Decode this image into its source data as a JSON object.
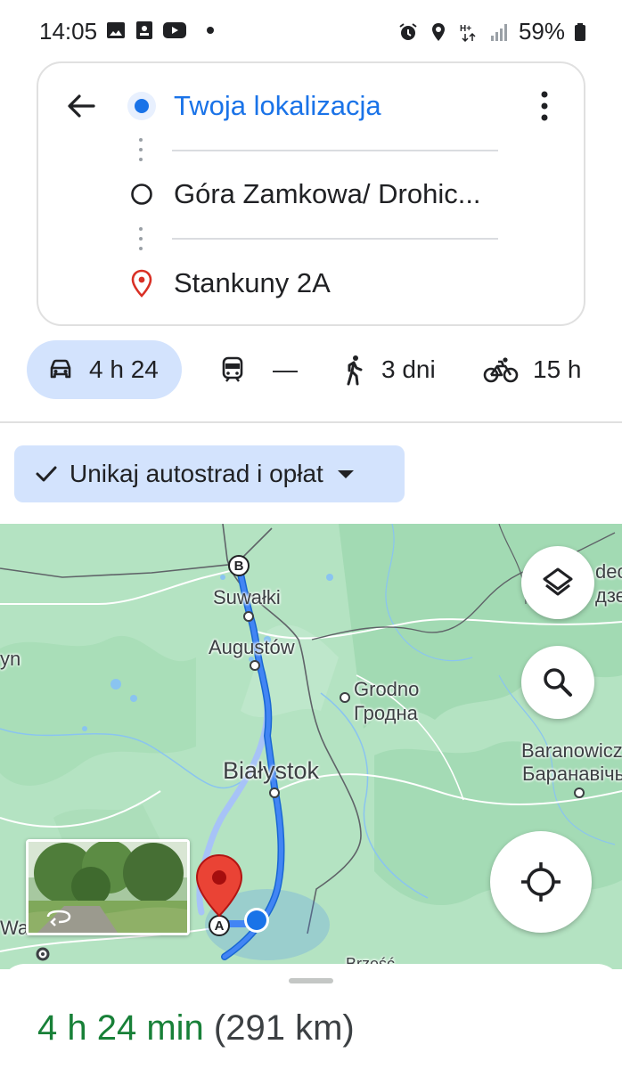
{
  "status_bar": {
    "time": "14:05",
    "battery": "59%",
    "left_icons": [
      "gallery-icon",
      "contact-card-icon",
      "youtube-icon",
      "dot-icon"
    ],
    "right_icons": [
      "alarm-icon",
      "location-icon",
      "hplus-icon",
      "signal-icon",
      "battery-icon"
    ],
    "network": "H+"
  },
  "directions": {
    "origin": "Twoja lokalizacja",
    "waypoint": "Góra Zamkowa/ Drohic...",
    "destination": "Stankuny 2A"
  },
  "modes": [
    {
      "name": "car",
      "icon": "car-icon",
      "label": "4 h 24",
      "active": true
    },
    {
      "name": "transit",
      "icon": "train-icon",
      "label": "—",
      "active": false
    },
    {
      "name": "walk",
      "icon": "walking-icon",
      "label": "3 dni",
      "active": false
    },
    {
      "name": "bike",
      "icon": "bicycle-icon",
      "label": "15 h",
      "active": false
    }
  ],
  "filter_chip": {
    "label": "Unikaj autostrad i opłat"
  },
  "map": {
    "labels": {
      "suwalki": "Suwałki",
      "augustow": "Augustów",
      "grodno_pl": "Grodno",
      "grodno_by": "Гродна",
      "bialystok": "Białystok",
      "baranowicze_pl": "Baranowicz",
      "baranowicze_by": "Баранавічы",
      "yn": "yn",
      "dec": "dec",
      "dze": "дзе",
      "war": "Wa",
      "brzesc": "Brześć"
    },
    "markers": {
      "a": "A",
      "b": "B"
    }
  },
  "summary": {
    "duration": "4 h 24 min",
    "distance": "(291 km)"
  },
  "colors": {
    "accent": "#1a73e8",
    "active_chip": "#d3e3fd",
    "duration_green": "#188038",
    "map_land": "#b8e5c6",
    "route": "#4285f4",
    "pin_red": "#ea4335"
  }
}
